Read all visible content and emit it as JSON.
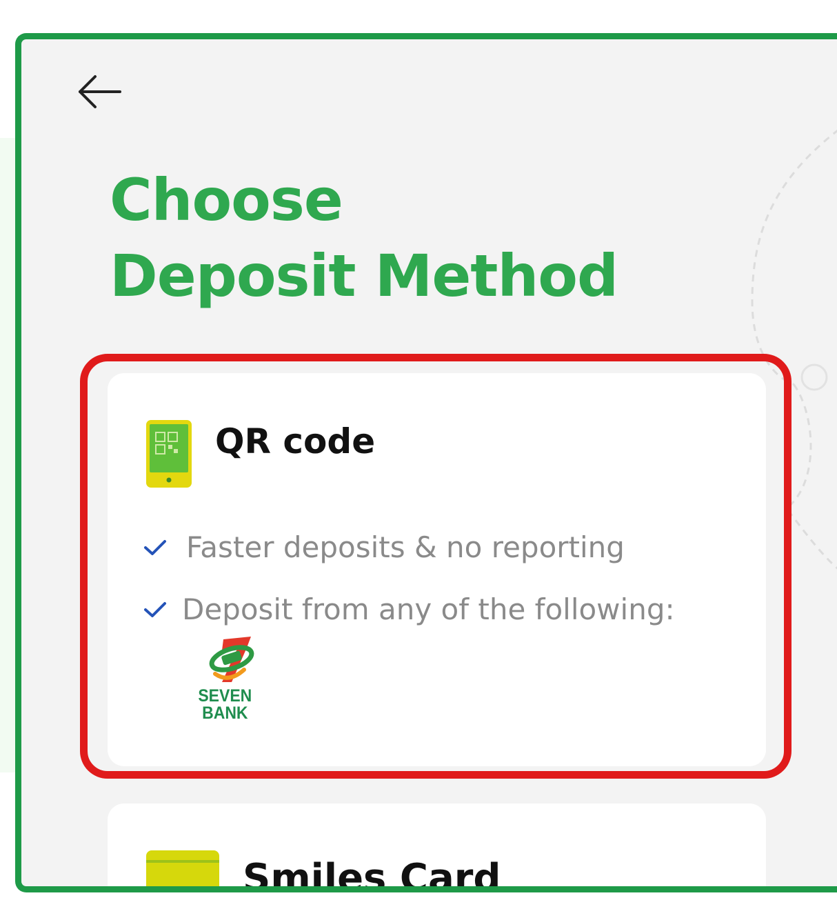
{
  "header": {
    "back_icon": "arrow-left-icon",
    "title_line1": "Choose",
    "title_line2": "Deposit Method"
  },
  "colors": {
    "accent_green": "#2fa84f",
    "frame_green": "#1e9a48",
    "highlight_red": "#e01b1b",
    "check_blue": "#2453b8",
    "qr_icon_yellow": "#e3d80f"
  },
  "methods": [
    {
      "title": "QR code",
      "icon": "qr-phone-icon",
      "features": [
        "Faster deposits & no reporting",
        "Deposit from any of the following:"
      ],
      "partners": [
        {
          "name": "SEVEN\nBANK",
          "icon": "seven-bank-logo"
        }
      ]
    },
    {
      "title": "Smiles Card",
      "icon": "card-icon"
    }
  ]
}
